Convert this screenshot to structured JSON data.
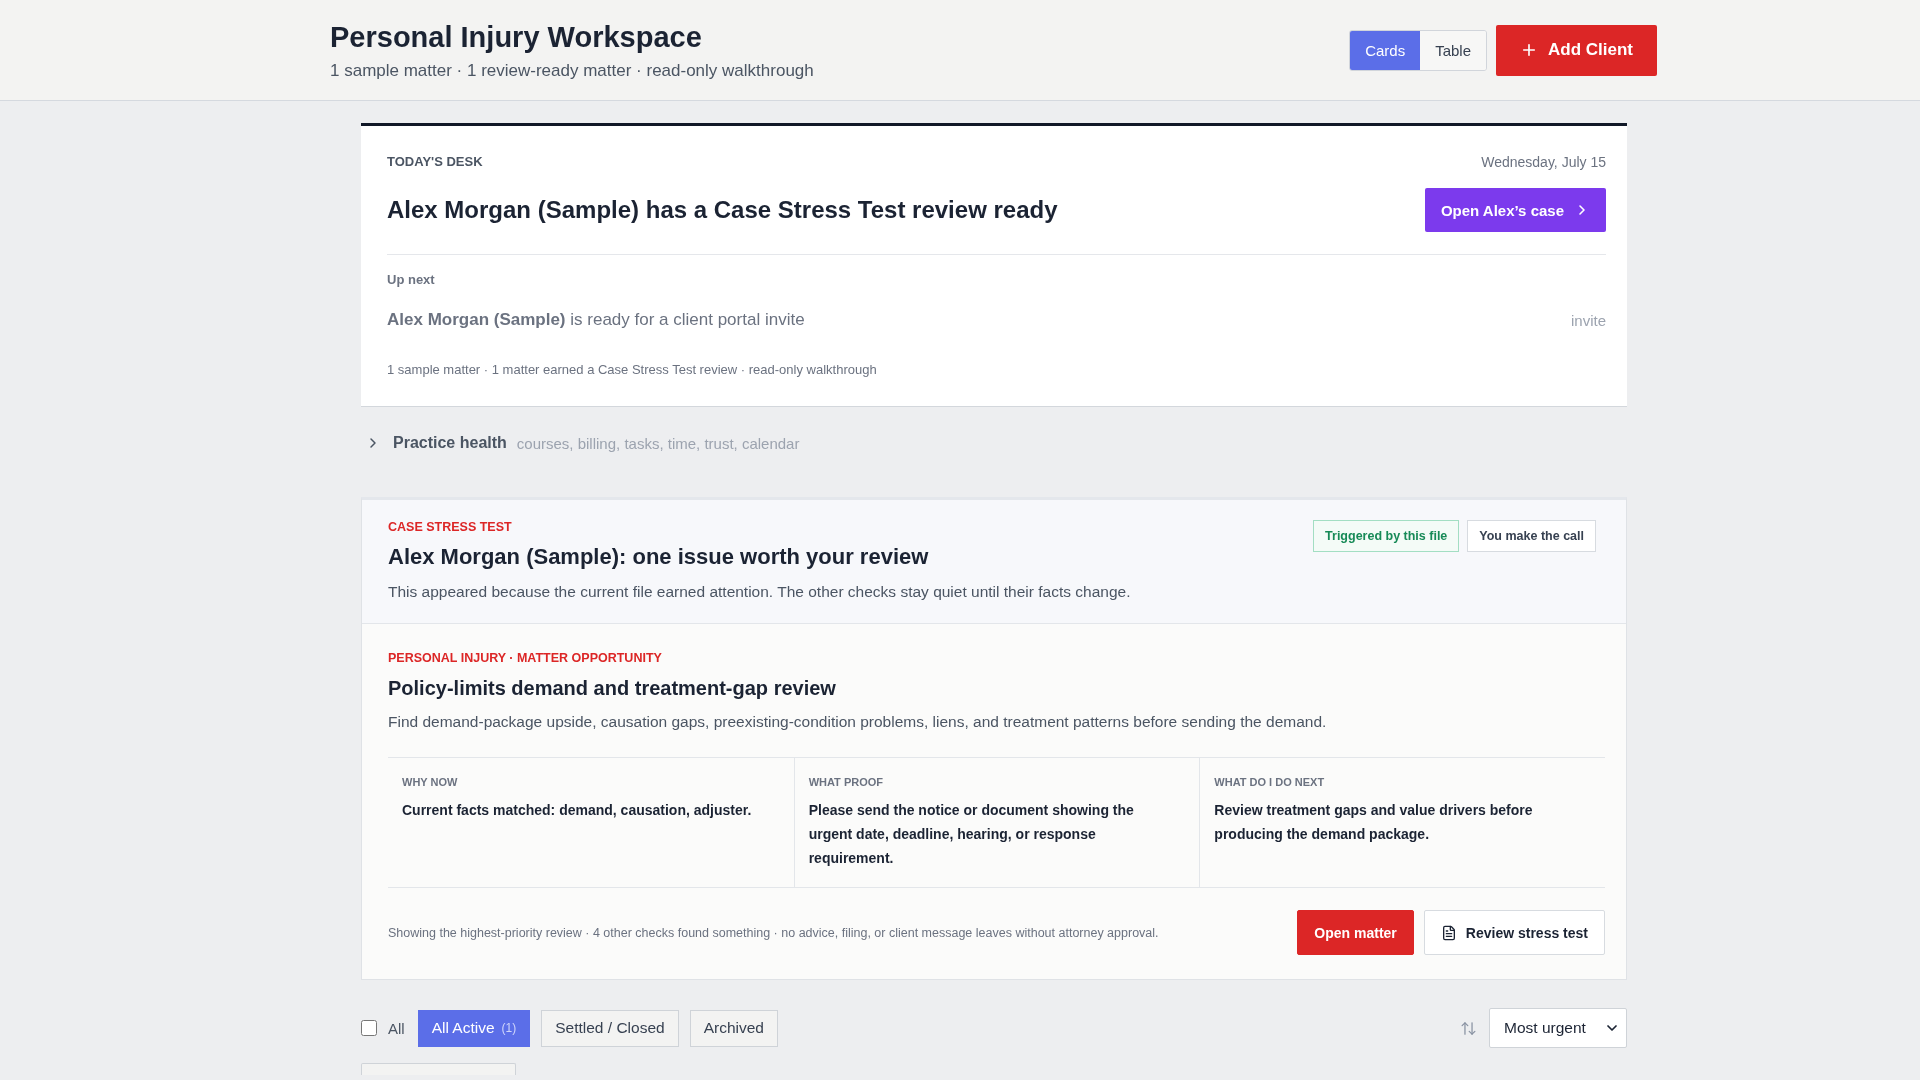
{
  "header": {
    "title": "Personal Injury Workspace",
    "subtitle": "1 sample matter · 1 review-ready matter · read-only walkthrough",
    "view_toggle": [
      {
        "label": "Cards",
        "selected": true
      },
      {
        "label": "Table",
        "selected": false
      }
    ],
    "add_button": {
      "label": "Add Client"
    }
  },
  "todays_desk": {
    "eyebrow": "TODAY'S DESK",
    "date": "Wednesday, July 15",
    "headline": "Alex Morgan (Sample) has a Case Stress Test review ready",
    "action": "Open Alex’s case",
    "up_next": {
      "label": "Up next",
      "text": "**Alex Morgan (Sample)** is ready for a client portal invite",
      "tag": "invite"
    },
    "summary": "1 sample matter · 1 matter earned a Case Stress Test review · read-only walkthrough"
  },
  "practice_health": {
    "label": "Practice health",
    "expanded": false,
    "areas": "courses, billing, tasks, time, trust, calendar"
  },
  "stress_test": {
    "eyebrow": "CASE STRESS TEST",
    "title": "Alex Morgan (Sample): one issue worth your review",
    "description": "This appeared because the current file earned attention. The other checks stay quiet until their facts change.",
    "badges": [
      {
        "label": "Triggered by this file",
        "kind": "trigger"
      },
      {
        "label": "You make the call",
        "kind": "neutral"
      }
    ],
    "opportunity": {
      "eyebrow": "PERSONAL INJURY · MATTER OPPORTUNITY",
      "title": "Policy-limits demand and treatment-gap review",
      "description": "Find demand-package upside, causation gaps, preexisting-condition problems, liens, and treatment patterns before sending the demand.",
      "columns": [
        {
          "label": "WHY NOW",
          "text": "Current facts matched: demand, causation, adjuster."
        },
        {
          "label": "WHAT PROOF",
          "text": "Please send the notice or document showing the urgent date, deadline, hearing, or response requirement."
        },
        {
          "label": "WHAT DO I DO NEXT",
          "text": "Review treatment gaps and value drivers before producing the demand package."
        }
      ]
    },
    "footer_note": "Showing the highest-priority review · 4 other checks found something · no advice, filing, or client message leaves without attorney approval.",
    "actions": [
      {
        "label": "Open matter",
        "kind": "primary"
      },
      {
        "label": "Review stress test",
        "kind": "document"
      }
    ]
  },
  "filters": {
    "select_all": {
      "label": "All",
      "checked": false
    },
    "tabs": [
      {
        "label": "All Active",
        "count": "(1)",
        "selected": true
      },
      {
        "label": "Settled / Closed",
        "selected": false
      },
      {
        "label": "Archived",
        "selected": false
      }
    ],
    "sort": {
      "value": "Most urgent"
    }
  }
}
